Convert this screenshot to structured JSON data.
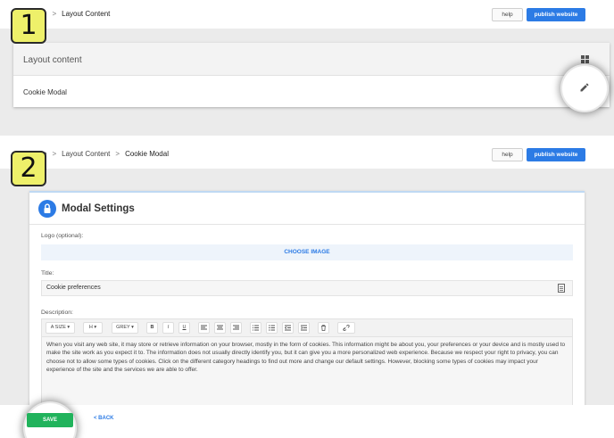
{
  "step1": {
    "badge": "1",
    "breadcrumb": {
      "partial": "e",
      "current": "Layout Content"
    },
    "help_label": "help",
    "publish_label": "publish website",
    "card_title": "Layout content",
    "row_label": "Cookie Modal",
    "icons": [
      "grid-icon",
      "pencil-edit-icon"
    ]
  },
  "step2": {
    "badge": "2",
    "breadcrumb": {
      "partial": "e",
      "middle": "Layout Content",
      "current": "Cookie Modal"
    },
    "help_label": "help",
    "publish_label": "publish website",
    "modal_title": "Modal Settings",
    "logo_label": "Logo (optional):",
    "choose_image_label": "CHOOSE IMAGE",
    "title_label": "Title:",
    "title_value": "Cookie preferences",
    "description_label": "Description:",
    "toolbar": {
      "size": "A SIZE ▾",
      "heading": "H ▾",
      "color": "GREY ▾",
      "bold": "B",
      "italic": "I",
      "underline": "U"
    },
    "description_text": "When you visit any web site, it may store or retrieve information on your browser, mostly in the form of cookies. This information might be about you, your preferences or your device and is mostly used to make the site work as you expect it to. The information does not usually directly identify you, but it can give you a more personalized web experience. Because we respect your right to privacy, you can choose not to allow some types of cookies. Click on the different category headings to find out more and change our default settings. However, blocking some types of cookies may impact your experience of the site and the services we are able to offer.",
    "save_label": "SAVE",
    "back_label": "< BACK"
  },
  "colors": {
    "accent": "#2c7be5",
    "save": "#21b35c",
    "badge": "#eef06a",
    "background": "#ebebeb"
  }
}
